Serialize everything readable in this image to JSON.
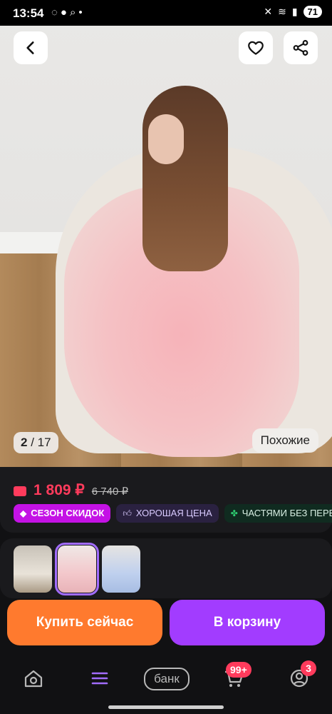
{
  "status_bar": {
    "time": "13:54",
    "battery": "71",
    "left_icons": [
      "chat-bubble-icon",
      "message-icon",
      "search-icon",
      "dot-icon"
    ],
    "right_icons": [
      "mute-icon",
      "wifi-icon",
      "signal-icon",
      "battery-icon"
    ]
  },
  "top_actions": {
    "back": "back-arrow-icon",
    "favorite": "heart-icon",
    "share": "share-icon"
  },
  "gallery": {
    "current": "2",
    "total": "17",
    "similar_label": "Похожие"
  },
  "price": {
    "current": "1 809 ₽",
    "old": "6 740 ₽",
    "color": "#ff3b5c"
  },
  "badges": [
    {
      "label": "СЕЗОН СКИДОК",
      "icon": "tag-icon",
      "color": "#c412e5"
    },
    {
      "label": "ХОРОШАЯ ЦЕНА",
      "icon": "thumbs-up-icon",
      "color": "#2a2140"
    },
    {
      "label": "ЧАСТЯМИ БЕЗ ПЕРЕП",
      "icon": "clover-icon",
      "color": "#102b20"
    }
  ],
  "thumbnails": [
    {
      "name": "white-dress"
    },
    {
      "name": "pink-dress",
      "selected": true
    },
    {
      "name": "blue-dress"
    }
  ],
  "buttons": {
    "buy_now": "Купить сейчас",
    "add_to_cart": "В корзину",
    "buy_color": "#ff7a2e",
    "cart_color": "#a23cff"
  },
  "bottom_nav": {
    "bank_label": "банк",
    "cart_badge": "99+",
    "profile_badge": "3"
  }
}
